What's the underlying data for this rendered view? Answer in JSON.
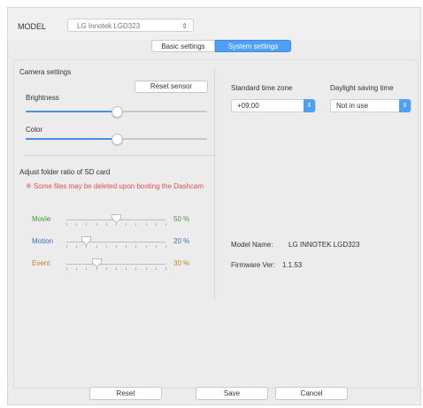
{
  "model": {
    "label": "MODEL",
    "value": "LG Innotek LGD323"
  },
  "tabs": [
    {
      "label": "Basic settings",
      "active": false
    },
    {
      "label": "System settings",
      "active": true
    }
  ],
  "camera": {
    "title": "Camera settings",
    "reset_sensor": "Reset sensor",
    "brightness": {
      "label": "Brightness",
      "level": 0.5
    },
    "color": {
      "label": "Color",
      "level": 0.5
    }
  },
  "sd": {
    "title": "Adjust folder ratio of SD card",
    "warning": "※ Some files may be deleted upon booting the Dashcam",
    "rows": [
      {
        "label": "Movie",
        "value": "50 %",
        "level": 0.5,
        "color": "#4a9a3a"
      },
      {
        "label": "Motion",
        "value": "20 %",
        "level": 0.2,
        "color": "#3a72b8"
      },
      {
        "label": "Event",
        "value": "30 %",
        "level": 0.3,
        "color": "#c8802a"
      }
    ]
  },
  "time": {
    "zone_label": "Standard time zone",
    "zone_value": "+09:00",
    "dst_label": "Daylight saving time",
    "dst_value": "Not in use"
  },
  "info": {
    "model_name_label": "Model Name:",
    "model_name_value": "LG INNOTEK LGD323",
    "firmware_label": "Firmware Ver:",
    "firmware_value": "1.1.53"
  },
  "footer": {
    "reset": "Reset",
    "save": "Save",
    "cancel": "Cancel"
  },
  "colors": {
    "accent": "#4ea0f6",
    "warning": "#e05252"
  }
}
